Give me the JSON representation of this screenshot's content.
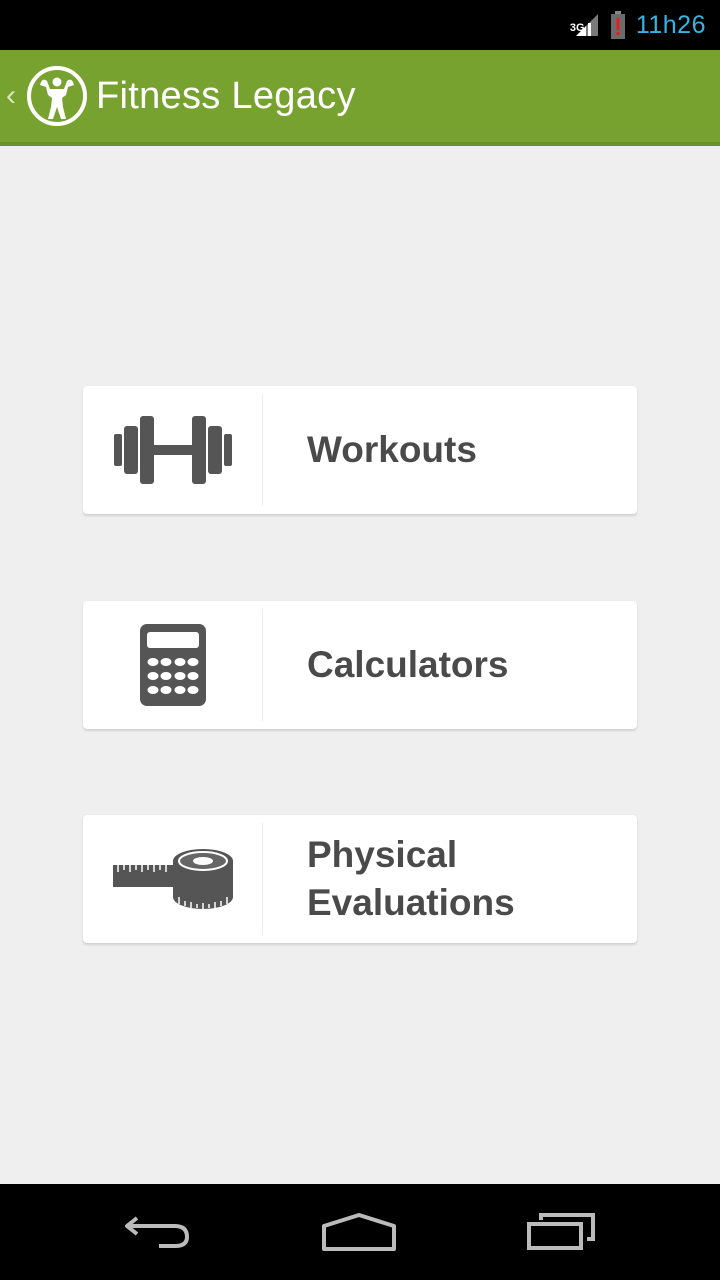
{
  "status_bar": {
    "network": "3G",
    "time": "11h26",
    "clock_color": "#33b5e5",
    "battery_alert": "!"
  },
  "action_bar": {
    "title": "Fitness Legacy",
    "background": "#78a22f",
    "up_icon": "chevron-left-icon",
    "logo_icon": "bodybuilder-logo-icon"
  },
  "menu": {
    "items": [
      {
        "label": "Workouts",
        "icon": "dumbbell-icon"
      },
      {
        "label": "Calculators",
        "icon": "calculator-icon"
      },
      {
        "label_line1": "Physical",
        "label_line2": "Evaluations",
        "icon": "measuring-tape-icon"
      }
    ]
  },
  "nav_bar": {
    "back_icon": "back-icon",
    "home_icon": "home-icon",
    "recents_icon": "recent-apps-icon"
  }
}
